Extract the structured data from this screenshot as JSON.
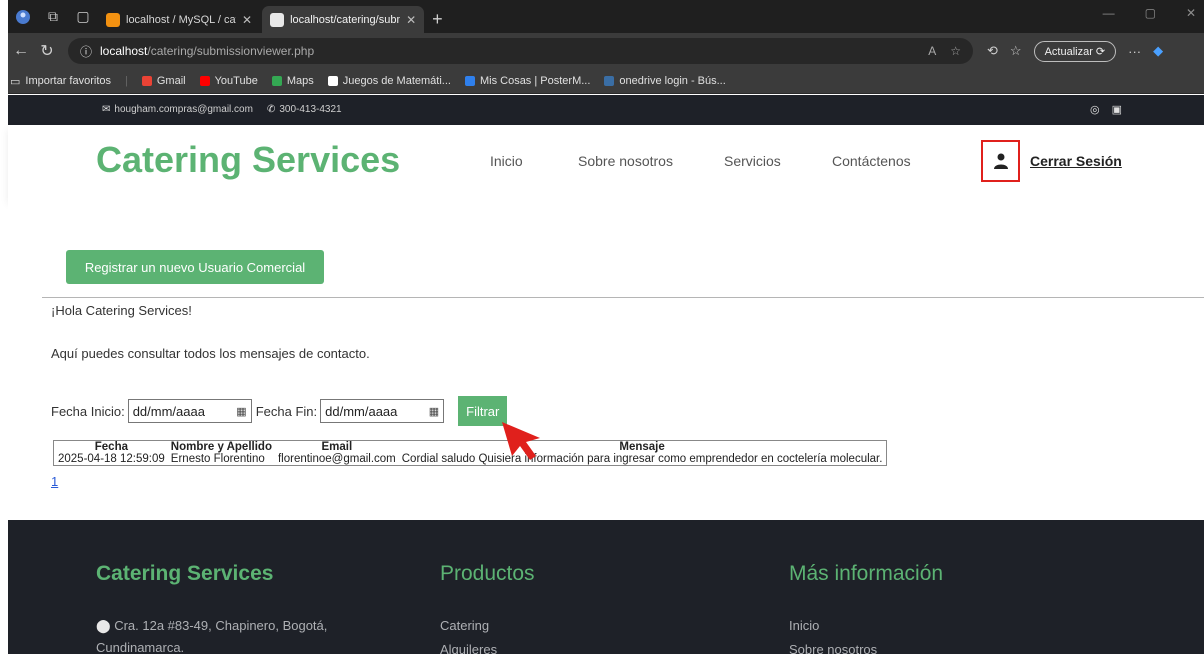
{
  "browser": {
    "tabs": [
      {
        "title": "localhost / MySQL / cateringdb /",
        "active": false,
        "favicon_color": "#f29111"
      },
      {
        "title": "localhost/catering/submissionviewer.php",
        "active": true,
        "favicon_color": "#e8e8e8"
      }
    ],
    "url_host": "localhost",
    "url_path": "/catering/submissionviewer.php",
    "update_button": "Actualizar",
    "favorites": [
      {
        "label": "Importar favoritos",
        "icon": "import-icon"
      },
      {
        "label": "Gmail",
        "icon": "gmail-icon",
        "color": "#ea4335"
      },
      {
        "label": "YouTube",
        "icon": "youtube-icon",
        "color": "#ff0000"
      },
      {
        "label": "Maps",
        "icon": "maps-icon",
        "color": "#34a853"
      },
      {
        "label": "Juegos de Matemáti...",
        "icon": "c-icon",
        "color": "#ffffff"
      },
      {
        "label": "Mis Cosas | PosterM...",
        "icon": "poster-icon",
        "color": "#2f80ed"
      },
      {
        "label": "onedrive login - Bús...",
        "icon": "search-icon",
        "color": "#3a6ea5"
      }
    ]
  },
  "topbar": {
    "email": "hougham.compras@gmail.com",
    "phone": "300-413-4321"
  },
  "header": {
    "brand": "Catering Services",
    "nav": [
      "Inicio",
      "Sobre nosotros",
      "Servicios",
      "Contáctenos"
    ],
    "logout": "Cerrar Sesión"
  },
  "main": {
    "register_button": "Registrar un nuevo Usuario Comercial",
    "greeting": "¡Hola Catering Services!",
    "description": "Aquí puedes consultar todos los mensajes de contacto.",
    "filter": {
      "start_label": "Fecha Inicio:",
      "start_value": "dd/mm/aaaa",
      "end_label": "Fecha Fin:",
      "end_value": "dd/mm/aaaa",
      "button": "Filtrar"
    },
    "table": {
      "headers": [
        "Fecha",
        "Nombre y Apellido",
        "Email",
        "Mensaje"
      ],
      "rows": [
        [
          "2025-04-18 12:59:09",
          "Ernesto Florentino",
          "florentinoe@gmail.com",
          "Cordial saludo Quisiera información para ingresar como emprendedor en coctelería molecular."
        ]
      ]
    },
    "pagination": "1"
  },
  "footer": {
    "col1_title": "Catering Services",
    "address_line1": "Cra. 12a #83-49, Chapinero, Bogotá,",
    "address_line2": "Cundinamarca.",
    "col2_title": "Productos",
    "col2_items": [
      "Catering",
      "Alquileres"
    ],
    "col3_title": "Más información",
    "col3_items": [
      "Inicio",
      "Sobre nosotros"
    ]
  },
  "colors": {
    "brand_green": "#5cb373",
    "dark_bg": "#1e2128",
    "highlight_red": "#e0201c"
  }
}
